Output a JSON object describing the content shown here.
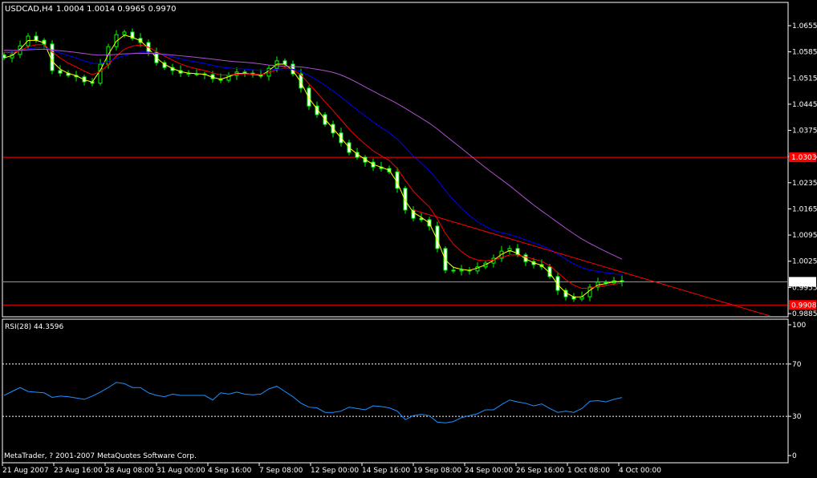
{
  "chart_header": {
    "symbol_timeframe": "USDCAD,H4",
    "ohlc": "1.0004 1.0014 0.9965 0.9970"
  },
  "copyright": "MetaTrader, ? 2001-2007 MetaQuotes Software Corp.",
  "colors": {
    "background": "#000000",
    "axis": "#ffffff",
    "candle": "#00ff00",
    "ma_fast": "#ffff00",
    "ma_mid": "#ff0000",
    "ma_slow": "#0000ff",
    "ma_long": "#b050d0",
    "level_line": "#ff0000",
    "bid_line": "#a0a0a0",
    "rsi_line": "#1e90ff"
  },
  "chart_data": [
    {
      "type": "candlestick",
      "title": "USDCAD,H4",
      "ylim": [
        0.9885,
        1.0655
      ],
      "y_ticks": [
        "1.0655",
        "1.0585",
        "1.0515",
        "1.0445",
        "1.0375",
        "1.0305",
        "1.0235",
        "1.0165",
        "1.0095",
        "1.0025",
        "0.9955",
        "0.9885"
      ],
      "x_ticks": [
        "21 Aug 2007",
        "23 Aug 16:00",
        "28 Aug 08:00",
        "31 Aug 00:00",
        "4 Sep 16:00",
        "7 Sep 08:00",
        "12 Sep 00:00",
        "14 Sep 16:00",
        "19 Sep 08:00",
        "24 Sep 00:00",
        "26 Sep 16:00",
        "1 Oct 08:00",
        "4 Oct 00:00"
      ],
      "closes": [
        1.0569,
        1.0578,
        1.0601,
        1.0627,
        1.0616,
        1.0606,
        1.0535,
        1.0528,
        1.0522,
        1.0518,
        1.0505,
        1.0501,
        1.0552,
        1.0599,
        1.0631,
        1.0638,
        1.0621,
        1.061,
        1.0584,
        1.0556,
        1.0543,
        1.0535,
        1.0528,
        1.0526,
        1.0526,
        1.0524,
        1.0513,
        1.0509,
        1.0522,
        1.0531,
        1.0528,
        1.0524,
        1.052,
        1.0541,
        1.0561,
        1.0552,
        1.0526,
        1.0488,
        1.044,
        1.0417,
        1.0391,
        1.0368,
        1.0342,
        1.0316,
        1.0303,
        1.029,
        1.0277,
        1.0273,
        1.0264,
        1.022,
        1.0162,
        1.014,
        1.0136,
        1.0119,
        1.0059,
        1.0001,
        0.9999,
        1.0001,
        0.9999,
        1.001,
        1.002,
        1.0033,
        1.0052,
        1.0059,
        1.0042,
        1.0024,
        1.0016,
        1.001,
        0.9984,
        0.9947,
        0.993,
        0.9924,
        0.993,
        0.9956,
        0.9969,
        0.9967,
        0.9973,
        0.997
      ],
      "levels": [
        {
          "label": "1.0303",
          "value": 1.0303
        },
        {
          "label": "0.9908",
          "value": 0.9908
        }
      ],
      "bid": {
        "label": "0.9970",
        "value": 0.997
      },
      "trendline": {
        "from": {
          "bar": 51,
          "price": 1.0162
        },
        "to": {
          "bar": 96,
          "price": 0.9875
        }
      }
    },
    {
      "type": "line",
      "title": "RSI(28) 44.3596",
      "ylim": [
        0,
        100
      ],
      "y_ticks": [
        "100",
        "70",
        "30",
        "0"
      ],
      "levels": [
        70,
        30
      ],
      "values": [
        46,
        49,
        52,
        49,
        48.5,
        48,
        44.5,
        45.5,
        45,
        44,
        43,
        45.5,
        48.5,
        52,
        56,
        55,
        52,
        52,
        48,
        46,
        45,
        47,
        46,
        46,
        46,
        46,
        42.5,
        48,
        47,
        48.5,
        47,
        46.5,
        47,
        51,
        53,
        49,
        45,
        40,
        37,
        36.5,
        33,
        33,
        34,
        37,
        36,
        35,
        38,
        37.5,
        36.5,
        34,
        27.5,
        30.5,
        31.5,
        30.5,
        25.5,
        25,
        26,
        29,
        30.5,
        32,
        35,
        35,
        39,
        42.5,
        41,
        40,
        38,
        39.5,
        36,
        33,
        34,
        33,
        36,
        41.5,
        42,
        41,
        43,
        44.4
      ]
    }
  ]
}
